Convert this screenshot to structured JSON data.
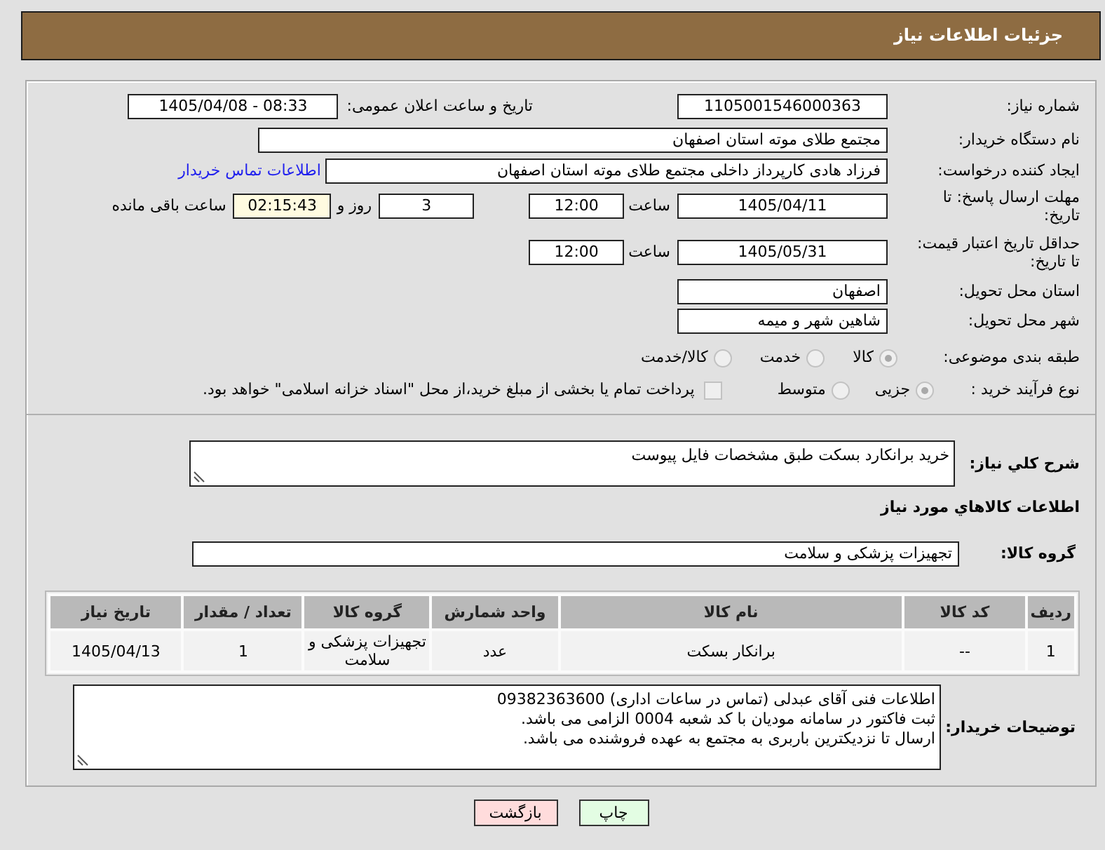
{
  "header": {
    "title": "جزئیات اطلاعات نیاز"
  },
  "need_number": {
    "label": "شماره نیاز:",
    "value": "1105001546000363"
  },
  "announcement": {
    "label": "تاریخ و ساعت اعلان عمومی:",
    "value": "1405/04/08 - 08:33"
  },
  "buyer_organization": {
    "label": "نام دستگاه خریدار:",
    "value": "مجتمع طلای موته استان اصفهان"
  },
  "requester": {
    "label": "ایجاد کننده درخواست:",
    "value": "فرزاد هادی کارپرداز داخلی مجتمع طلای موته استان اصفهان",
    "contact_link": "اطلاعات تماس خریدار"
  },
  "response_deadline": {
    "label": "مهلت ارسال پاسخ: تا تاریخ:",
    "date": "1405/04/11",
    "time_label": "ساعت",
    "time": "12:00",
    "days": "3",
    "days_label": "روز و",
    "remaining": "02:15:43",
    "remaining_label": "ساعت باقی مانده"
  },
  "price_validity": {
    "label": "حداقل تاریخ اعتبار قیمت: تا تاریخ:",
    "date": "1405/05/31",
    "time_label": "ساعت",
    "time": "12:00"
  },
  "delivery_province": {
    "label": "استان محل تحویل:",
    "value": "اصفهان"
  },
  "delivery_city": {
    "label": "شهر محل تحویل:",
    "value": "شاهین شهر و میمه"
  },
  "subject_category": {
    "label": "طبقه بندی موضوعی:",
    "options": [
      {
        "label": "کالا",
        "selected": true,
        "disabled": true
      },
      {
        "label": "خدمت",
        "selected": false,
        "disabled": true
      },
      {
        "label": "کالا/خدمت",
        "selected": false,
        "disabled": true
      }
    ]
  },
  "purchase_process": {
    "label": "نوع فرآیند خرید :",
    "options": [
      {
        "label": "جزیی",
        "selected": true,
        "disabled": true
      },
      {
        "label": "متوسط",
        "selected": false,
        "disabled": true
      }
    ],
    "treasury_option": {
      "label": "پرداخت تمام یا بخشی از مبلغ خرید،از محل \"اسناد خزانه اسلامی\" خواهد بود.",
      "checked": false,
      "disabled": true
    }
  },
  "general_description": {
    "label": "شرح کلي نياز:",
    "value": "خرید برانکارد بسکت طبق مشخصات فایل پیوست"
  },
  "goods_section": {
    "title": "اطلاعات کالاهاي مورد نياز"
  },
  "goods_group": {
    "label": "گروه کالا:",
    "value": "تجهیزات پزشکی و سلامت"
  },
  "items_table": {
    "columns": [
      "ردیف",
      "کد کالا",
      "نام کالا",
      "واحد شمارش",
      "گروه کالا",
      "تعداد / مقدار",
      "تاریخ نیاز"
    ],
    "rows": [
      [
        "1",
        "--",
        "برانکار بسکت",
        "عدد",
        "تجهیزات پزشکی و سلامت",
        "1",
        "1405/04/13"
      ]
    ]
  },
  "buyer_notes": {
    "label": "توضیحات خریدار:",
    "lines": [
      "اطلاعات فنی آقای عبدلی (تماس در ساعات اداری) 09382363600",
      "ثبت فاکتور در سامانه مودیان با کد شعبه 0004 الزامی می باشد.",
      "ارسال تا نزدیکترین باربری به مجتمع به عهده فروشنده می باشد."
    ]
  },
  "buttons": [
    {
      "label": "چاپ",
      "kind": "print"
    },
    {
      "label": "بازگشت",
      "kind": "back"
    }
  ]
}
